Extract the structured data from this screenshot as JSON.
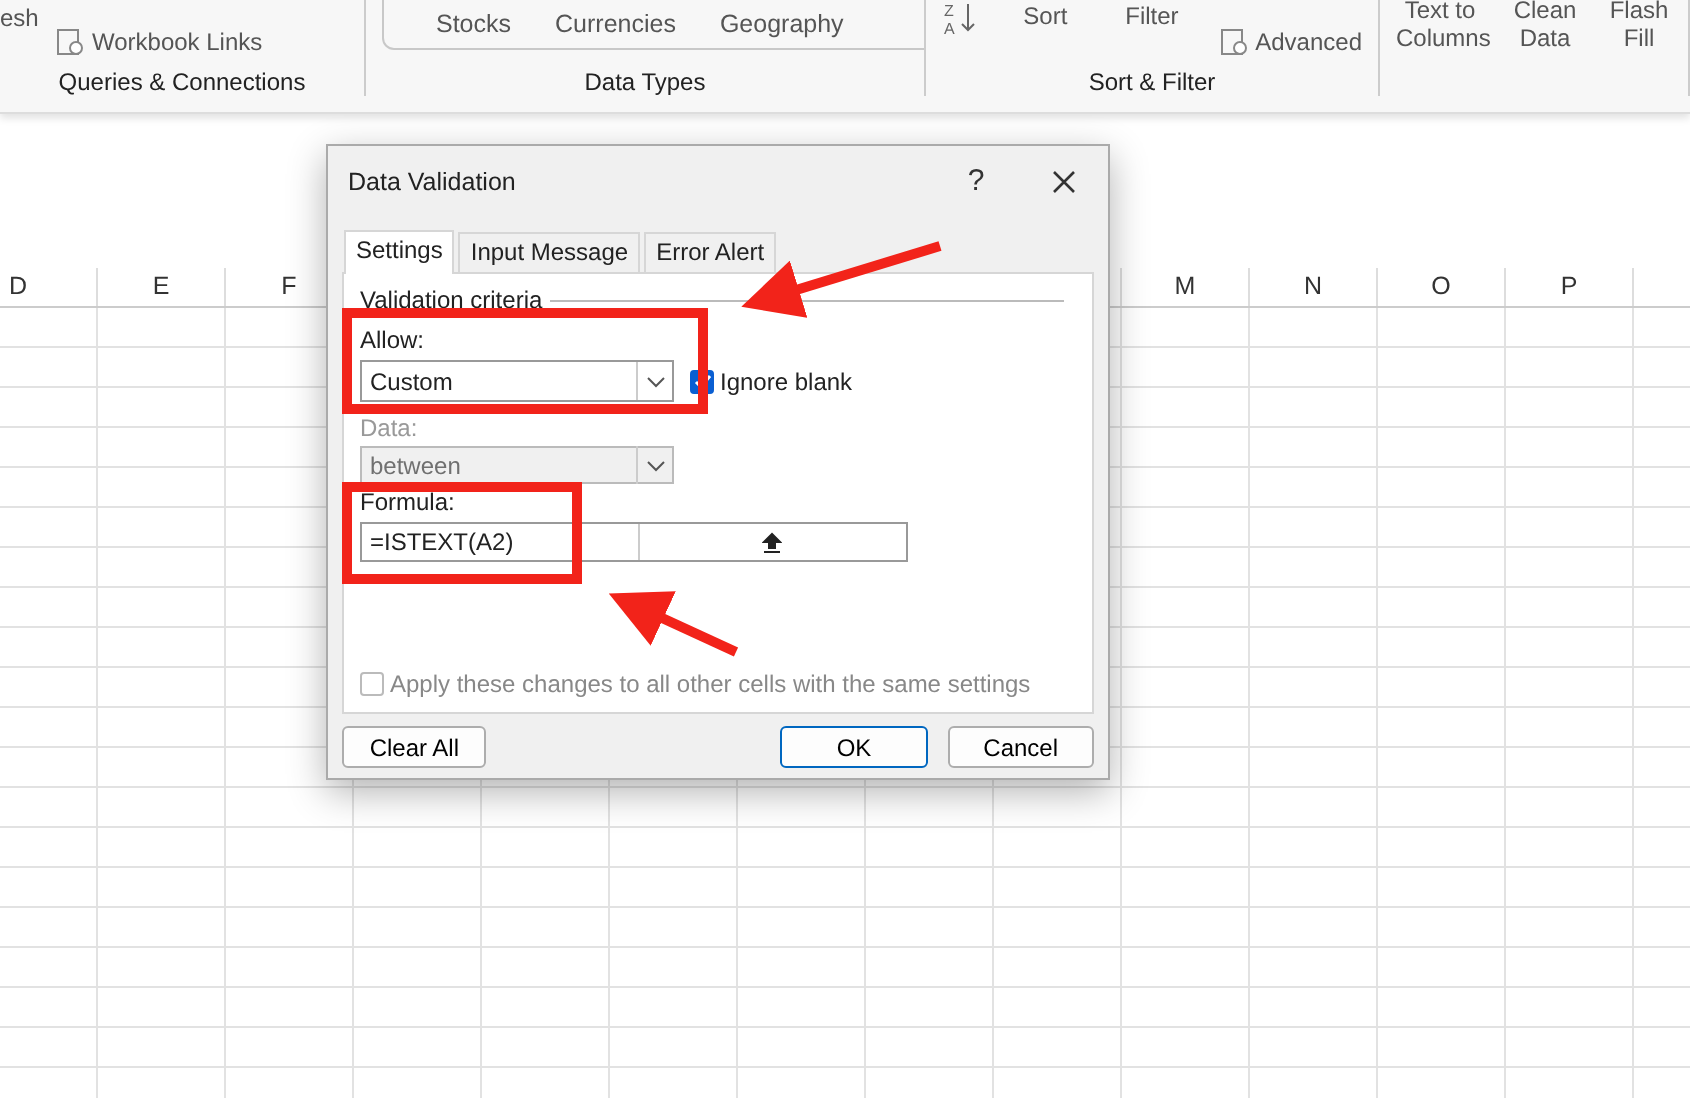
{
  "ribbon": {
    "groups": [
      {
        "label": "Queries & Connections",
        "items": [
          {
            "kind": "cut",
            "text": "esh"
          },
          {
            "kind": "small",
            "text": "Workbook Links"
          }
        ]
      },
      {
        "label": "Data Types",
        "items": [
          {
            "kind": "gallery",
            "texts": [
              "Stocks",
              "Currencies",
              "Geography"
            ]
          }
        ]
      },
      {
        "label": "Sort & Filter",
        "items": [
          {
            "kind": "sortaz",
            "letters": [
              "Z",
              "A"
            ]
          },
          {
            "kind": "big",
            "text": "Sort"
          },
          {
            "kind": "big",
            "text": "Filter"
          },
          {
            "kind": "small",
            "text": "Advanced"
          }
        ]
      },
      {
        "items": [
          {
            "kind": "big",
            "text": "Text to Columns"
          },
          {
            "kind": "big",
            "text": "Clean Data"
          },
          {
            "kind": "big",
            "text": "Flash Fill"
          }
        ]
      }
    ]
  },
  "sheet": {
    "columns_left": [
      "D",
      "E",
      "F"
    ],
    "columns_right": [
      "M",
      "N",
      "O",
      "P"
    ]
  },
  "dialog": {
    "title": "Data Validation",
    "help": "?",
    "tabs": [
      {
        "label": "Settings",
        "selected": true
      },
      {
        "label": "Input Message",
        "selected": false
      },
      {
        "label": "Error Alert",
        "selected": false
      }
    ],
    "section": "Validation criteria",
    "allow": {
      "label": "Allow:",
      "value": "Custom",
      "disabled": false
    },
    "ignore_blank": {
      "label": "Ignore blank",
      "checked": true
    },
    "data": {
      "label": "Data:",
      "value": "between",
      "disabled": true
    },
    "formula": {
      "label": "Formula:",
      "value": "=ISTEXT(A2)"
    },
    "apply_all": {
      "label": "Apply these changes to all other cells with the same settings",
      "checked": false,
      "disabled": true
    },
    "buttons": [
      {
        "label": "Clear All",
        "kind": "normal"
      },
      {
        "label": "OK",
        "kind": "default"
      },
      {
        "label": "Cancel",
        "kind": "normal"
      }
    ]
  }
}
